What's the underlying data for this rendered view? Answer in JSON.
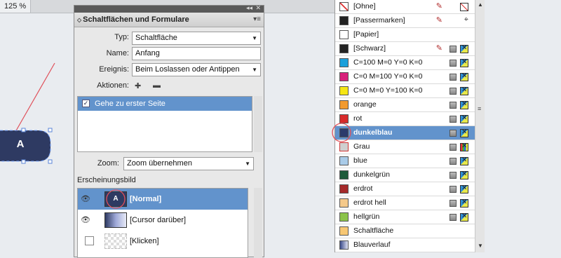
{
  "document": {
    "zoom_tab": "125 %",
    "button_text": "A"
  },
  "panel": {
    "title": "Schaltflächen und Formulare",
    "type_label": "Typ:",
    "type_value": "Schaltfläche",
    "name_label": "Name:",
    "name_value": "Anfang",
    "event_label": "Ereignis:",
    "event_value": "Beim Loslassen oder Antippen",
    "actions_label": "Aktionen:",
    "action_items": [
      {
        "label": "Gehe zu erster Seite",
        "checked": true
      }
    ],
    "zoom_label": "Zoom:",
    "zoom_value": "Zoom übernehmen",
    "appearance_heading": "Erscheinungsbild",
    "appearance_states": [
      {
        "label": "[Normal]",
        "thumb": "A",
        "selected": true
      },
      {
        "label": "[Cursor darüber]",
        "thumb": "",
        "selected": false
      },
      {
        "label": "[Klicken]",
        "thumb": "",
        "selected": false
      }
    ]
  },
  "swatches": {
    "items": [
      {
        "name": "[Ohne]",
        "color": "#ffffff"
      },
      {
        "name": "[Passermarken]",
        "color": "#222222"
      },
      {
        "name": "[Papier]",
        "color": "#ffffff"
      },
      {
        "name": "[Schwarz]",
        "color": "#222222"
      },
      {
        "name": "C=100 M=0 Y=0 K=0",
        "color": "#1ba0db"
      },
      {
        "name": "C=0 M=100 Y=0 K=0",
        "color": "#d8207a"
      },
      {
        "name": "C=0 M=0 Y=100 K=0",
        "color": "#f5e614"
      },
      {
        "name": "orange",
        "color": "#f29a2e"
      },
      {
        "name": "rot",
        "color": "#d82a2a"
      },
      {
        "name": "dunkelblau",
        "color": "#2b3a6b",
        "selected": true
      },
      {
        "name": "Grau",
        "color": "#cfcfcf"
      },
      {
        "name": "blue",
        "color": "#a9cbe8"
      },
      {
        "name": "dunkelgrün",
        "color": "#1f5a3a"
      },
      {
        "name": "erdrot",
        "color": "#a52a2a"
      },
      {
        "name": "erdrot hell",
        "color": "#f5c98a"
      },
      {
        "name": "hellgrün",
        "color": "#8bc34a"
      },
      {
        "name": "Schaltfläche",
        "color": "#f7c773"
      },
      {
        "name": "Blauverlauf",
        "color": "#3a4a8a"
      }
    ]
  },
  "colors": {
    "selection_blue": "#6293cc",
    "button_navy": "#2e3a62",
    "annotation_red": "#e0505a"
  }
}
